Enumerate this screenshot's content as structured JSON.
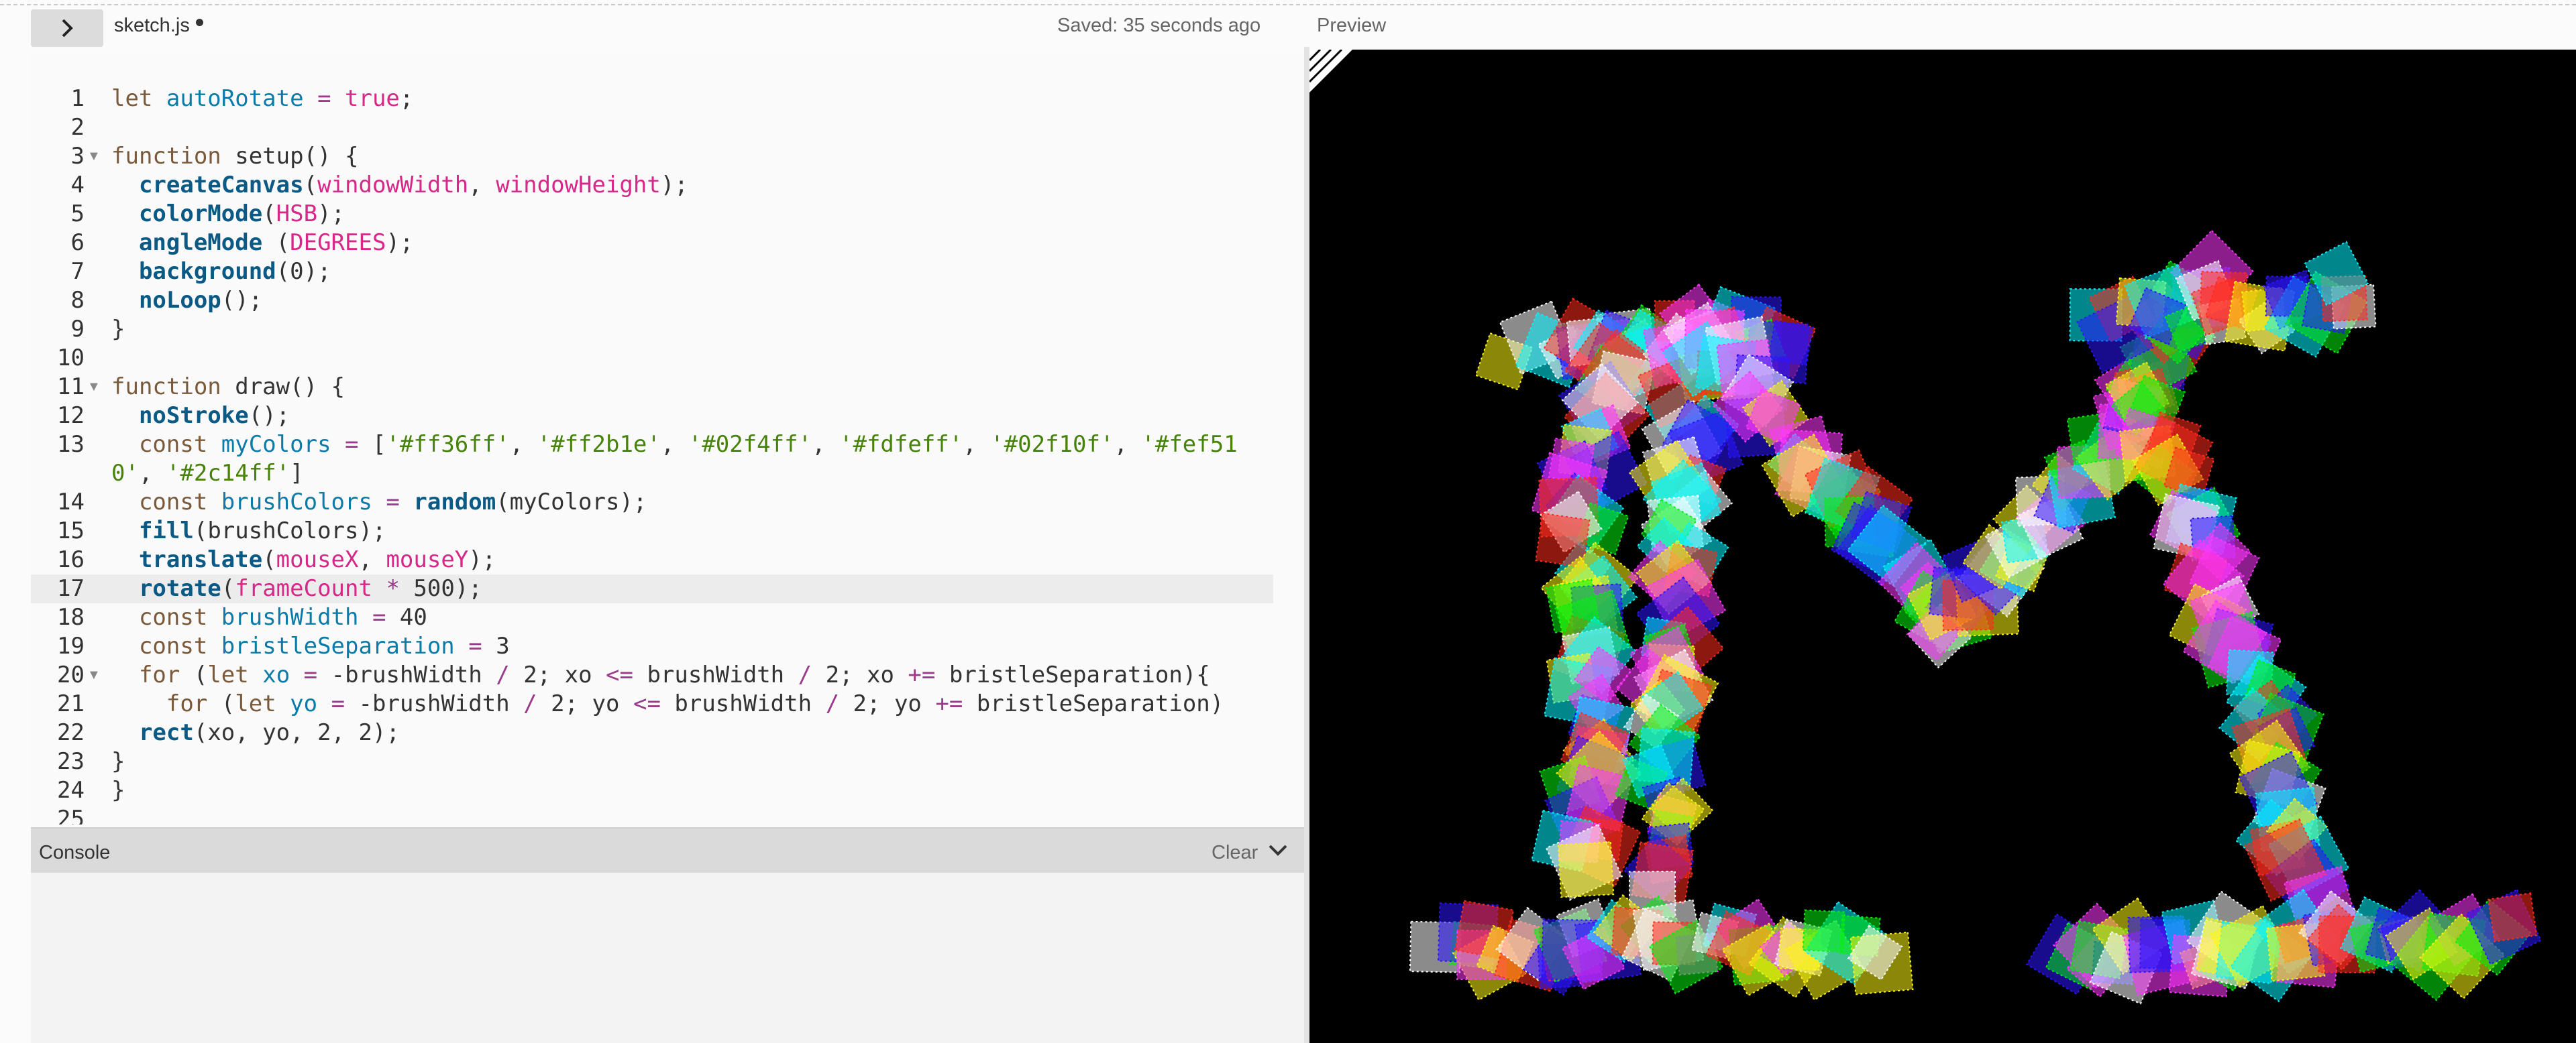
{
  "header": {
    "file_name": "sketch.js",
    "saved_status": "Saved: 35 seconds ago",
    "preview_label": "Preview",
    "toggle_icon": "chevron-right-icon"
  },
  "editor": {
    "lines": [
      {
        "num": "1",
        "fold": false,
        "tokens": [
          [
            "kw",
            "let "
          ],
          [
            "var",
            "autoRotate"
          ],
          [
            "op",
            " = "
          ],
          [
            "const",
            "true"
          ],
          [
            "plain",
            ";"
          ]
        ]
      },
      {
        "num": "2",
        "fold": false,
        "tokens": []
      },
      {
        "num": "3",
        "fold": true,
        "tokens": [
          [
            "kw",
            "function "
          ],
          [
            "plain",
            "setup() {"
          ]
        ]
      },
      {
        "num": "4",
        "fold": false,
        "tokens": [
          [
            "plain",
            "  "
          ],
          [
            "fn",
            "createCanvas"
          ],
          [
            "plain",
            "("
          ],
          [
            "const",
            "windowWidth"
          ],
          [
            "plain",
            ", "
          ],
          [
            "const",
            "windowHeight"
          ],
          [
            "plain",
            ");"
          ]
        ]
      },
      {
        "num": "5",
        "fold": false,
        "tokens": [
          [
            "plain",
            "  "
          ],
          [
            "fn",
            "colorMode"
          ],
          [
            "plain",
            "("
          ],
          [
            "const",
            "HSB"
          ],
          [
            "plain",
            ");"
          ]
        ]
      },
      {
        "num": "6",
        "fold": false,
        "tokens": [
          [
            "plain",
            "  "
          ],
          [
            "fn",
            "angleMode"
          ],
          [
            "plain",
            " ("
          ],
          [
            "const",
            "DEGREES"
          ],
          [
            "plain",
            ");"
          ]
        ]
      },
      {
        "num": "7",
        "fold": false,
        "tokens": [
          [
            "plain",
            "  "
          ],
          [
            "fn",
            "background"
          ],
          [
            "plain",
            "("
          ],
          [
            "num",
            "0"
          ],
          [
            "plain",
            ");"
          ]
        ]
      },
      {
        "num": "8",
        "fold": false,
        "tokens": [
          [
            "plain",
            "  "
          ],
          [
            "fn",
            "noLoop"
          ],
          [
            "plain",
            "();"
          ]
        ]
      },
      {
        "num": "9",
        "fold": false,
        "tokens": [
          [
            "plain",
            "}"
          ]
        ]
      },
      {
        "num": "10",
        "fold": false,
        "tokens": []
      },
      {
        "num": "11",
        "fold": true,
        "tokens": [
          [
            "kw",
            "function "
          ],
          [
            "plain",
            "draw() {"
          ]
        ]
      },
      {
        "num": "12",
        "fold": false,
        "tokens": [
          [
            "plain",
            "  "
          ],
          [
            "fn",
            "noStroke"
          ],
          [
            "plain",
            "();"
          ]
        ]
      },
      {
        "num": "13",
        "fold": false,
        "wrapped": true,
        "tokens": [
          [
            "plain",
            "  "
          ],
          [
            "kw",
            "const "
          ],
          [
            "var",
            "myColors"
          ],
          [
            "op",
            " = "
          ],
          [
            "plain",
            "["
          ],
          [
            "str",
            "'#ff36ff'"
          ],
          [
            "plain",
            ", "
          ],
          [
            "str",
            "'#ff2b1e'"
          ],
          [
            "plain",
            ", "
          ],
          [
            "str",
            "'#02f4ff'"
          ],
          [
            "plain",
            ", "
          ],
          [
            "str",
            "'#fdfeff'"
          ],
          [
            "plain",
            ", "
          ],
          [
            "str",
            "'#02f10f'"
          ],
          [
            "plain",
            ", "
          ],
          [
            "str",
            "'#fef510'"
          ],
          [
            "plain",
            ", "
          ],
          [
            "str",
            "'#2c14ff'"
          ],
          [
            "plain",
            "]"
          ]
        ]
      },
      {
        "num": "14",
        "fold": false,
        "tokens": [
          [
            "plain",
            "  "
          ],
          [
            "kw",
            "const "
          ],
          [
            "var",
            "brushColors"
          ],
          [
            "op",
            " = "
          ],
          [
            "fn",
            "random"
          ],
          [
            "plain",
            "(myColors);"
          ]
        ]
      },
      {
        "num": "15",
        "fold": false,
        "tokens": [
          [
            "plain",
            "  "
          ],
          [
            "fn",
            "fill"
          ],
          [
            "plain",
            "(brushColors);"
          ]
        ]
      },
      {
        "num": "16",
        "fold": false,
        "tokens": [
          [
            "plain",
            "  "
          ],
          [
            "fn",
            "translate"
          ],
          [
            "plain",
            "("
          ],
          [
            "const",
            "mouseX"
          ],
          [
            "plain",
            ", "
          ],
          [
            "const",
            "mouseY"
          ],
          [
            "plain",
            ");"
          ]
        ]
      },
      {
        "num": "17",
        "fold": false,
        "active": true,
        "tokens": [
          [
            "plain",
            "  "
          ],
          [
            "fn",
            "rotate"
          ],
          [
            "plain",
            "("
          ],
          [
            "const",
            "frameCount"
          ],
          [
            "op",
            " * "
          ],
          [
            "num",
            "500"
          ],
          [
            "plain",
            ");"
          ]
        ]
      },
      {
        "num": "18",
        "fold": false,
        "tokens": [
          [
            "plain",
            "  "
          ],
          [
            "kw",
            "const "
          ],
          [
            "var",
            "brushWidth"
          ],
          [
            "op",
            " = "
          ],
          [
            "num",
            "40"
          ]
        ]
      },
      {
        "num": "19",
        "fold": false,
        "tokens": [
          [
            "plain",
            "  "
          ],
          [
            "kw",
            "const "
          ],
          [
            "var",
            "bristleSeparation"
          ],
          [
            "op",
            " = "
          ],
          [
            "num",
            "3"
          ]
        ]
      },
      {
        "num": "20",
        "fold": true,
        "tokens": [
          [
            "plain",
            "  "
          ],
          [
            "kw",
            "for "
          ],
          [
            "plain",
            "("
          ],
          [
            "kw",
            "let "
          ],
          [
            "var",
            "xo"
          ],
          [
            "op",
            " = "
          ],
          [
            "plain",
            "-brushWidth "
          ],
          [
            "op",
            "/ "
          ],
          [
            "num",
            "2"
          ],
          [
            "plain",
            "; xo "
          ],
          [
            "op",
            "<= "
          ],
          [
            "plain",
            "brushWidth "
          ],
          [
            "op",
            "/ "
          ],
          [
            "num",
            "2"
          ],
          [
            "plain",
            "; xo "
          ],
          [
            "op",
            "+= "
          ],
          [
            "plain",
            "bristleSeparation){"
          ]
        ]
      },
      {
        "num": "21",
        "fold": false,
        "tokens": [
          [
            "plain",
            "    "
          ],
          [
            "kw",
            "for "
          ],
          [
            "plain",
            "("
          ],
          [
            "kw",
            "let "
          ],
          [
            "var",
            "yo"
          ],
          [
            "op",
            " = "
          ],
          [
            "plain",
            "-brushWidth "
          ],
          [
            "op",
            "/ "
          ],
          [
            "num",
            "2"
          ],
          [
            "plain",
            "; yo "
          ],
          [
            "op",
            "<= "
          ],
          [
            "plain",
            "brushWidth "
          ],
          [
            "op",
            "/ "
          ],
          [
            "num",
            "2"
          ],
          [
            "plain",
            "; yo "
          ],
          [
            "op",
            "+= "
          ],
          [
            "plain",
            "bristleSeparation)"
          ]
        ]
      },
      {
        "num": "22",
        "fold": false,
        "tokens": [
          [
            "plain",
            "  "
          ],
          [
            "fn",
            "rect"
          ],
          [
            "plain",
            "(xo, yo, "
          ],
          [
            "num",
            "2"
          ],
          [
            "plain",
            ", "
          ],
          [
            "num",
            "2"
          ],
          [
            "plain",
            ");"
          ]
        ]
      },
      {
        "num": "23",
        "fold": false,
        "tokens": [
          [
            "plain",
            "}"
          ]
        ]
      },
      {
        "num": "24",
        "fold": false,
        "tokens": [
          [
            "plain",
            "}"
          ]
        ]
      },
      {
        "num": "25",
        "fold": false,
        "tokens": []
      }
    ]
  },
  "console": {
    "label": "Console",
    "clear_label": "Clear",
    "collapse_icon": "chevron-down-icon"
  },
  "preview": {
    "background": "#000000",
    "palette": [
      "#ff36ff",
      "#ff2b1e",
      "#02f4ff",
      "#fdfeff",
      "#02f10f",
      "#fef510",
      "#2c14ff"
    ]
  },
  "colors": {
    "keyword": "#7a5a3a",
    "variable": "#0b7ca9",
    "function": "#0b5a86",
    "string": "#47820a",
    "constant": "#d52889",
    "operator": "#9b3b8b"
  }
}
